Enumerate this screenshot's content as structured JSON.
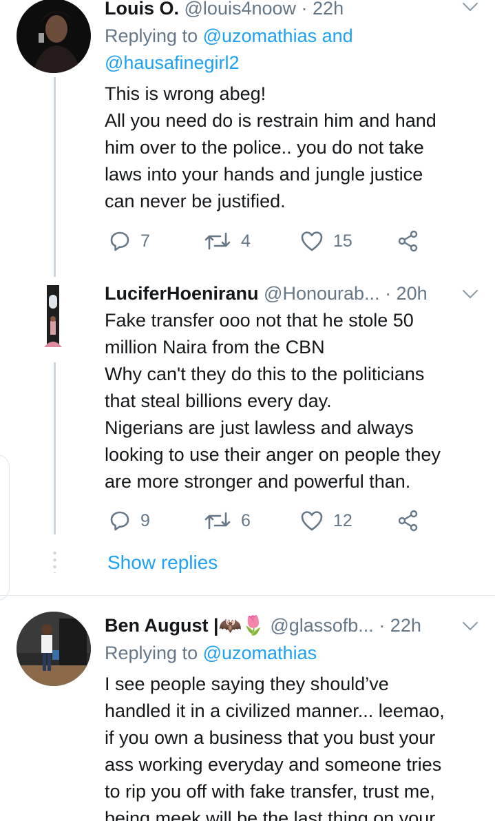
{
  "tweets": [
    {
      "name": "Louis O.",
      "handle": "@louis4noow",
      "time": "· 22h",
      "replying_prefix": "Replying to",
      "replying_mentions_line1": "@uzomathias and",
      "replying_mentions_line2": "@hausafinegirl2",
      "lines": [
        "This is wrong abeg!",
        "All you need do is restrain him and hand",
        "him over to the police.. you do not take",
        "laws into your hands and jungle justice",
        "can never be justified."
      ],
      "replies": "7",
      "retweets": "4",
      "likes": "15"
    },
    {
      "name": "LuciferHoeniranu",
      "handle": "@Honourab...",
      "time": "· 20h",
      "lines": [
        "Fake transfer ooo not that he stole 50",
        "million Naira from the CBN",
        "Why can't they do this to the politicians",
        "that steal billions every day.",
        "Nigerians are just lawless and always",
        "looking to use their anger on people they",
        "are more stronger and powerful than."
      ],
      "replies": "9",
      "retweets": "6",
      "likes": "12",
      "show_replies": "Show replies"
    },
    {
      "name": "Ben August |🦇🌷",
      "handle": "@glassofb...",
      "time": "· 22h",
      "replying_prefix": "Replying to",
      "replying_mentions_line1": "@uzomathias",
      "lines": [
        "I see people saying they should’ve",
        "handled it in a civilized manner... leemao,",
        "if you own a business that you bust your",
        "ass working everyday and someone tries",
        "to rip you off with fake transfer, trust me,",
        "being meek will be the last thing on your"
      ]
    }
  ],
  "icons": {
    "reply": "speech-bubble-icon",
    "retweet": "retweet-icon",
    "like": "heart-icon",
    "share": "share-icon",
    "more": "chevron-down-icon"
  },
  "colors": {
    "link": "#1da1f2",
    "secondary_text": "#657786",
    "primary_text": "#14171a"
  }
}
